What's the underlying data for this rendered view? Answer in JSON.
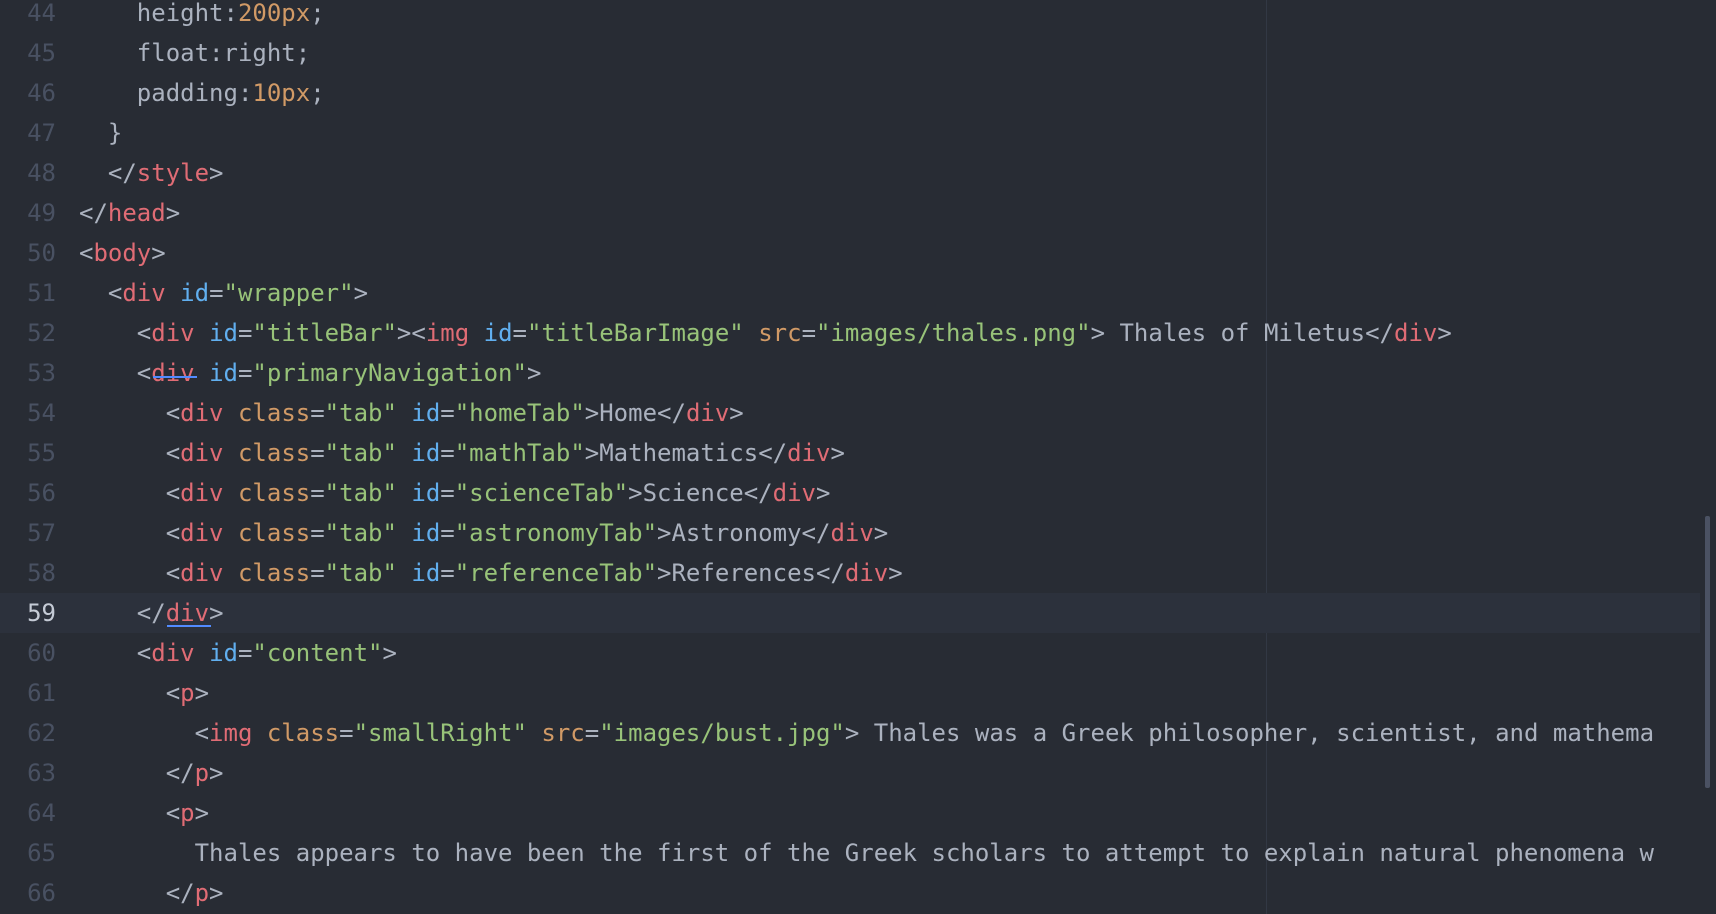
{
  "editor": {
    "lines": [
      {
        "num": "44",
        "tokens": [
          [
            "prop",
            "    height"
          ],
          [
            "punc",
            ":"
          ],
          [
            "num",
            "200px"
          ],
          [
            "punc",
            ";"
          ]
        ]
      },
      {
        "num": "45",
        "tokens": [
          [
            "prop",
            "    float"
          ],
          [
            "punc",
            ":"
          ],
          [
            "text",
            "right"
          ],
          [
            "punc",
            ";"
          ]
        ]
      },
      {
        "num": "46",
        "tokens": [
          [
            "prop",
            "    padding"
          ],
          [
            "punc",
            ":"
          ],
          [
            "num",
            "10px"
          ],
          [
            "punc",
            ";"
          ]
        ]
      },
      {
        "num": "47",
        "tokens": [
          [
            "punc",
            "  }"
          ]
        ]
      },
      {
        "num": "48",
        "tokens": [
          [
            "punc",
            "  </"
          ],
          [
            "tag",
            "style"
          ],
          [
            "punc",
            ">"
          ]
        ]
      },
      {
        "num": "49",
        "tokens": [
          [
            "punc",
            "</"
          ],
          [
            "tag",
            "head"
          ],
          [
            "punc",
            ">"
          ]
        ]
      },
      {
        "num": "50",
        "tokens": [
          [
            "punc",
            "<"
          ],
          [
            "tag",
            "body"
          ],
          [
            "punc",
            ">"
          ]
        ]
      },
      {
        "num": "51",
        "tokens": [
          [
            "punc",
            "  <"
          ],
          [
            "tag",
            "div"
          ],
          [
            "punc",
            " "
          ],
          [
            "attr",
            "id"
          ],
          [
            "punc",
            "="
          ],
          [
            "str",
            "\"wrapper\""
          ],
          [
            "punc",
            ">"
          ]
        ]
      },
      {
        "num": "52",
        "tokens": [
          [
            "punc",
            "    <"
          ],
          [
            "tag",
            "div"
          ],
          [
            "punc",
            " "
          ],
          [
            "attr",
            "id"
          ],
          [
            "punc",
            "="
          ],
          [
            "str",
            "\"titleBar\""
          ],
          [
            "punc",
            "><"
          ],
          [
            "tag",
            "img"
          ],
          [
            "punc",
            " "
          ],
          [
            "attr",
            "id"
          ],
          [
            "punc",
            "="
          ],
          [
            "str",
            "\"titleBarImage\""
          ],
          [
            "punc",
            " "
          ],
          [
            "attr2",
            "src"
          ],
          [
            "punc",
            "="
          ],
          [
            "str",
            "\"images/thales.png\""
          ],
          [
            "punc",
            ">"
          ],
          [
            "text",
            " Thales of Miletus"
          ],
          [
            "punc",
            "</"
          ],
          [
            "tag",
            "div"
          ],
          [
            "punc",
            ">"
          ]
        ]
      },
      {
        "num": "53",
        "tokens": [
          [
            "punc",
            "    <"
          ],
          [
            "tag",
            "div"
          ],
          [
            "punc",
            " "
          ],
          [
            "attr",
            "id"
          ],
          [
            "punc",
            "="
          ],
          [
            "str",
            "\"primaryNavigation\""
          ],
          [
            "punc",
            ">"
          ]
        ]
      },
      {
        "num": "54",
        "tokens": [
          [
            "punc",
            "      <"
          ],
          [
            "tag",
            "div"
          ],
          [
            "punc",
            " "
          ],
          [
            "attr2",
            "class"
          ],
          [
            "punc",
            "="
          ],
          [
            "str",
            "\"tab\""
          ],
          [
            "punc",
            " "
          ],
          [
            "attr",
            "id"
          ],
          [
            "punc",
            "="
          ],
          [
            "str",
            "\"homeTab\""
          ],
          [
            "punc",
            ">"
          ],
          [
            "text",
            "Home"
          ],
          [
            "punc",
            "</"
          ],
          [
            "tag",
            "div"
          ],
          [
            "punc",
            ">"
          ]
        ]
      },
      {
        "num": "55",
        "tokens": [
          [
            "punc",
            "      <"
          ],
          [
            "tag",
            "div"
          ],
          [
            "punc",
            " "
          ],
          [
            "attr2",
            "class"
          ],
          [
            "punc",
            "="
          ],
          [
            "str",
            "\"tab\""
          ],
          [
            "punc",
            " "
          ],
          [
            "attr",
            "id"
          ],
          [
            "punc",
            "="
          ],
          [
            "str",
            "\"mathTab\""
          ],
          [
            "punc",
            ">"
          ],
          [
            "text",
            "Mathematics"
          ],
          [
            "punc",
            "</"
          ],
          [
            "tag",
            "div"
          ],
          [
            "punc",
            ">"
          ]
        ]
      },
      {
        "num": "56",
        "tokens": [
          [
            "punc",
            "      <"
          ],
          [
            "tag",
            "div"
          ],
          [
            "punc",
            " "
          ],
          [
            "attr2",
            "class"
          ],
          [
            "punc",
            "="
          ],
          [
            "str",
            "\"tab\""
          ],
          [
            "punc",
            " "
          ],
          [
            "attr",
            "id"
          ],
          [
            "punc",
            "="
          ],
          [
            "str",
            "\"scienceTab\""
          ],
          [
            "punc",
            ">"
          ],
          [
            "text",
            "Science"
          ],
          [
            "punc",
            "</"
          ],
          [
            "tag",
            "div"
          ],
          [
            "punc",
            ">"
          ]
        ]
      },
      {
        "num": "57",
        "tokens": [
          [
            "punc",
            "      <"
          ],
          [
            "tag",
            "div"
          ],
          [
            "punc",
            " "
          ],
          [
            "attr2",
            "class"
          ],
          [
            "punc",
            "="
          ],
          [
            "str",
            "\"tab\""
          ],
          [
            "punc",
            " "
          ],
          [
            "attr",
            "id"
          ],
          [
            "punc",
            "="
          ],
          [
            "str",
            "\"astronomyTab\""
          ],
          [
            "punc",
            ">"
          ],
          [
            "text",
            "Astronomy"
          ],
          [
            "punc",
            "</"
          ],
          [
            "tag",
            "div"
          ],
          [
            "punc",
            ">"
          ]
        ]
      },
      {
        "num": "58",
        "tokens": [
          [
            "punc",
            "      <"
          ],
          [
            "tag",
            "div"
          ],
          [
            "punc",
            " "
          ],
          [
            "attr2",
            "class"
          ],
          [
            "punc",
            "="
          ],
          [
            "str",
            "\"tab\""
          ],
          [
            "punc",
            " "
          ],
          [
            "attr",
            "id"
          ],
          [
            "punc",
            "="
          ],
          [
            "str",
            "\"referenceTab\""
          ],
          [
            "punc",
            ">"
          ],
          [
            "text",
            "References"
          ],
          [
            "punc",
            "</"
          ],
          [
            "tag",
            "div"
          ],
          [
            "punc",
            ">"
          ]
        ]
      },
      {
        "num": "59",
        "active": true,
        "tokens": [
          [
            "punc",
            "    </"
          ],
          [
            "tag",
            "div"
          ],
          [
            "punc",
            ">"
          ]
        ]
      },
      {
        "num": "60",
        "tokens": [
          [
            "punc",
            "    <"
          ],
          [
            "tag",
            "div"
          ],
          [
            "punc",
            " "
          ],
          [
            "attr",
            "id"
          ],
          [
            "punc",
            "="
          ],
          [
            "str",
            "\"content\""
          ],
          [
            "punc",
            ">"
          ]
        ]
      },
      {
        "num": "61",
        "tokens": [
          [
            "punc",
            "      <"
          ],
          [
            "tag",
            "p"
          ],
          [
            "punc",
            ">"
          ]
        ]
      },
      {
        "num": "62",
        "tokens": [
          [
            "punc",
            "        <"
          ],
          [
            "tag",
            "img"
          ],
          [
            "punc",
            " "
          ],
          [
            "attr2",
            "class"
          ],
          [
            "punc",
            "="
          ],
          [
            "str",
            "\"smallRight\""
          ],
          [
            "punc",
            " "
          ],
          [
            "attr2",
            "src"
          ],
          [
            "punc",
            "="
          ],
          [
            "str",
            "\"images/bust.jpg\""
          ],
          [
            "punc",
            ">"
          ],
          [
            "text",
            " Thales was a Greek philosopher, scientist, and mathema"
          ]
        ]
      },
      {
        "num": "63",
        "tokens": [
          [
            "punc",
            "      </"
          ],
          [
            "tag",
            "p"
          ],
          [
            "punc",
            ">"
          ]
        ]
      },
      {
        "num": "64",
        "tokens": [
          [
            "punc",
            "      <"
          ],
          [
            "tag",
            "p"
          ],
          [
            "punc",
            ">"
          ]
        ]
      },
      {
        "num": "65",
        "tokens": [
          [
            "text",
            "        Thales appears to have been the first of the Greek scholars to attempt to explain natural phenomena w"
          ]
        ]
      },
      {
        "num": "66",
        "tokens": [
          [
            "punc",
            "      </"
          ],
          [
            "tag",
            "p"
          ],
          [
            "punc",
            ">"
          ]
        ]
      }
    ]
  }
}
